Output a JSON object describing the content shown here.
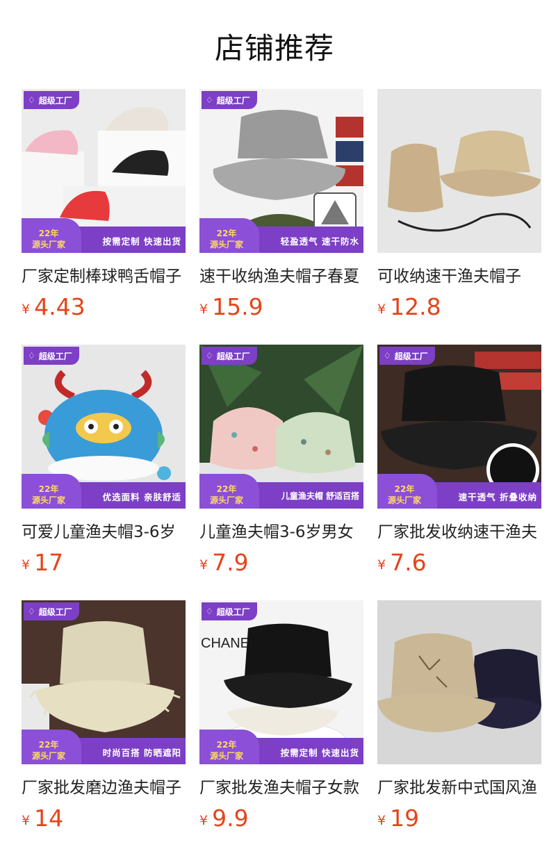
{
  "section_title": "店铺推荐",
  "badge": {
    "label": "超级工厂",
    "icon": "diamond-icon"
  },
  "currency": "¥",
  "products": [
    {
      "name": "厂家定制棒球鸭舌帽子",
      "price": "4.43",
      "promo": true,
      "years": "22年",
      "origin": "源头厂家",
      "features": "按需定制  快速出货",
      "scene": "caps"
    },
    {
      "name": "速干收纳渔夫帽子春夏",
      "price": "15.9",
      "promo": true,
      "years": "22年",
      "origin": "源头厂家",
      "features": "轻盈透气  速干防水",
      "scene": "gray-bucket"
    },
    {
      "name": "可收纳速干渔夫帽子",
      "price": "12.8",
      "promo": false,
      "scene": "khaki-bucket"
    },
    {
      "name": "可爱儿童渔夫帽3-6岁",
      "price": "17",
      "promo": true,
      "years": "22年",
      "origin": "源头厂家",
      "features": "优选面料  亲肤舒适",
      "scene": "dragon-hat"
    },
    {
      "name": "儿童渔夫帽3-6岁男女",
      "price": "7.9",
      "promo": true,
      "years": "22年",
      "origin": "源头厂家",
      "features": "儿童渔夫帽 舒适百搭",
      "scene": "pattern-bucket"
    },
    {
      "name": "厂家批发收纳速干渔夫",
      "price": "7.6",
      "promo": true,
      "years": "22年",
      "origin": "源头厂家",
      "features": "速干透气  折叠收纳",
      "scene": "black-bucket"
    },
    {
      "name": "厂家批发磨边渔夫帽子",
      "price": "14",
      "promo": true,
      "years": "22年",
      "origin": "源头厂家",
      "features": "时尚百搭  防晒遮阳",
      "scene": "frayed-bucket"
    },
    {
      "name": "厂家批发渔夫帽子女款",
      "price": "9.9",
      "promo": true,
      "years": "22年",
      "origin": "源头厂家",
      "features": "按需定制  快速出货",
      "scene": "stacked-bucket",
      "scene_text": "CHANE"
    },
    {
      "name": "厂家批发新中式国风渔",
      "price": "19",
      "promo": false,
      "scene": "embroidered-bucket"
    }
  ]
}
